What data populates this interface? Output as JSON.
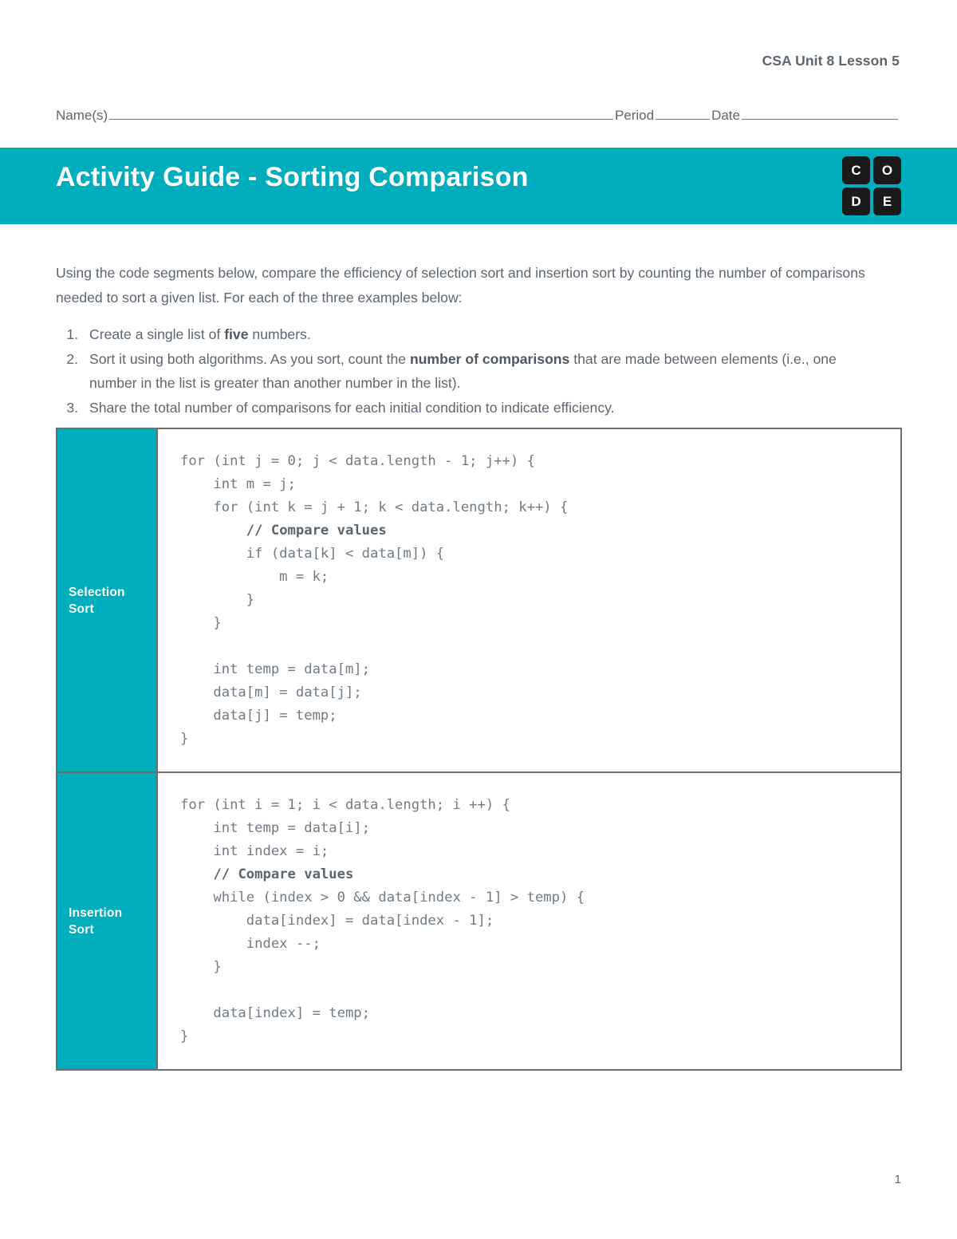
{
  "header": {
    "course_label": "CSA Unit 8 Lesson 5"
  },
  "name_line": {
    "name_label": "Name(s)",
    "period_label": "Period",
    "date_label": "Date",
    "name_value": "",
    "period_value": "",
    "date_value": ""
  },
  "banner": {
    "title": "Activity Guide - Sorting Comparison",
    "background_color": "#00adbd",
    "logo": {
      "name": "code-org-logo",
      "tiles": [
        "C",
        "O",
        "D",
        "E"
      ],
      "tile_color": "#1a1a1a"
    }
  },
  "intro": {
    "paragraph": "Using the code segments below, compare the efficiency of selection sort and insertion sort by counting the number of comparisons needed to sort a given list. For each of the three examples below:"
  },
  "steps": [
    {
      "number": "1.",
      "parts": [
        {
          "text": "Create a single list of ",
          "bold": false
        },
        {
          "text": "five",
          "bold": true
        },
        {
          "text": " numbers.",
          "bold": false
        }
      ]
    },
    {
      "number": "2.",
      "parts": [
        {
          "text": "Sort it using both algorithms. As you sort, count the ",
          "bold": false
        },
        {
          "text": "number of comparisons",
          "bold": true
        },
        {
          "text": " that are made between elements (i.e., one number in the list is greater than another number in the list).",
          "bold": false
        }
      ]
    },
    {
      "number": "3.",
      "parts": [
        {
          "text": "Share the total number of comparisons for each initial condition to indicate efficiency.",
          "bold": false
        }
      ]
    }
  ],
  "code_table": {
    "rows": [
      {
        "label_line1": "Selection",
        "label_line2": "Sort",
        "code_parts": [
          {
            "text": "for (int j = 0; j < data.length - 1; j++) {\n    int m = j;\n    for (int k = j + 1; k < data.length; k++) {\n        ",
            "bold": false
          },
          {
            "text": "// Compare values",
            "bold": true
          },
          {
            "text": "\n        if (data[k] < data[m]) {\n            m = k;\n        }\n    }\n\n    int temp = data[m];\n    data[m] = data[j];\n    data[j] = temp;\n}",
            "bold": false
          }
        ]
      },
      {
        "label_line1": "Insertion",
        "label_line2": "Sort",
        "code_parts": [
          {
            "text": "for (int i = 1; i < data.length; i ++) {\n    int temp = data[i];\n    int index = i;\n    ",
            "bold": false
          },
          {
            "text": "// Compare values",
            "bold": true
          },
          {
            "text": "\n    while (index > 0 && data[index - 1] > temp) {\n        data[index] = data[index - 1];\n        index --;\n    }\n\n    data[index] = temp;\n}",
            "bold": false
          }
        ]
      }
    ]
  },
  "footer": {
    "page_number": "1"
  }
}
